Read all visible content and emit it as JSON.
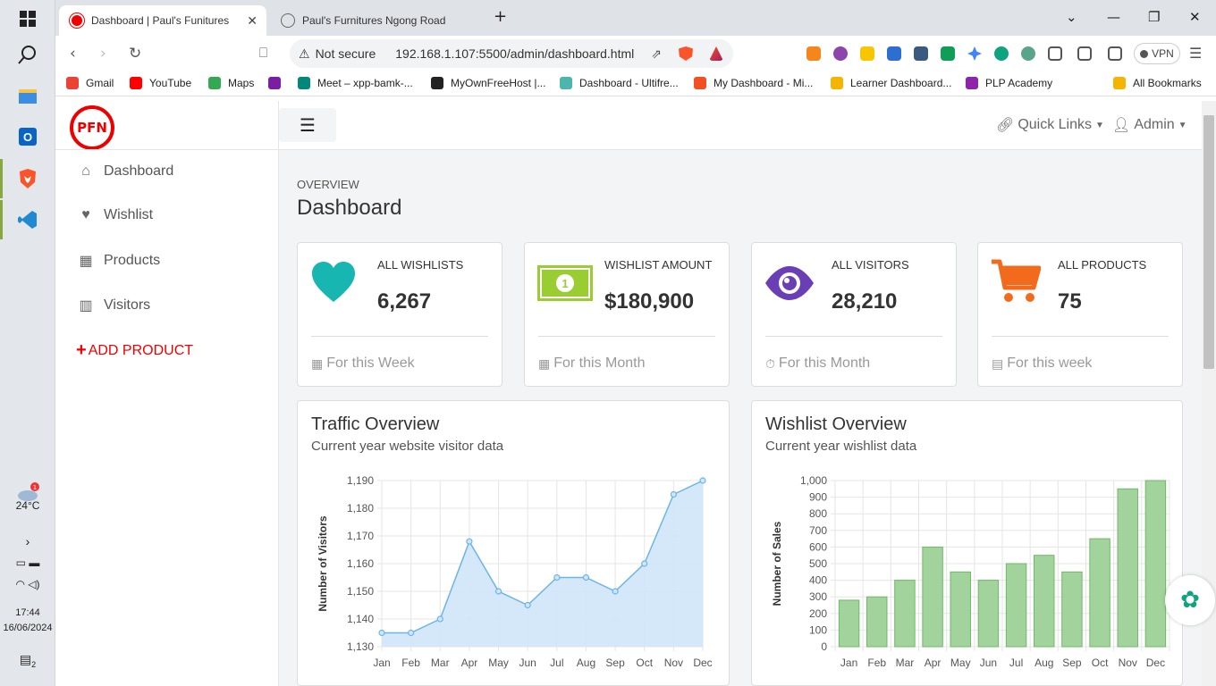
{
  "taskbar": {
    "weather_badge": "1",
    "temperature": "24°C",
    "time": "17:44",
    "date": "16/06/2024",
    "notification_count": "2"
  },
  "tabs": [
    {
      "title": "Dashboard | Paul's Funitures",
      "active": true
    },
    {
      "title": "Paul's Furnitures Ngong Road",
      "active": false
    }
  ],
  "address": {
    "security": "Not secure",
    "url": "192.168.1.107:5500/admin/dashboard.html",
    "vpn_label": "VPN"
  },
  "bookmarks": [
    {
      "label": "Gmail",
      "color": "#ea4335"
    },
    {
      "label": "YouTube",
      "color": "#ff0000"
    },
    {
      "label": "Maps",
      "color": "#34a853"
    },
    {
      "label": "Meet – xpp-bamk-...",
      "color": "#00897b"
    },
    {
      "label": "MyOwnFreeHost |...",
      "color": "#222222"
    },
    {
      "label": "Dashboard - Ultifre...",
      "color": "#4db6ac"
    },
    {
      "label": "My Dashboard - Mi...",
      "color": "#f25022"
    },
    {
      "label": "Learner Dashboard...",
      "color": "#f4b400"
    },
    {
      "label": "PLP Academy",
      "color": "#8e24aa"
    }
  ],
  "all_bookmarks": "All Bookmarks",
  "sidebar": {
    "logo_text": "PFN",
    "items": [
      {
        "label": "Dashboard",
        "icon": "home-icon"
      },
      {
        "label": "Wishlist",
        "icon": "heart-icon"
      },
      {
        "label": "Products",
        "icon": "table-icon"
      },
      {
        "label": "Visitors",
        "icon": "bar-chart-icon"
      }
    ],
    "add_product": "ADD PRODUCT"
  },
  "topnav": {
    "quick_links": "Quick Links",
    "admin": "Admin"
  },
  "header": {
    "overline": "OVERVIEW",
    "title": "Dashboard"
  },
  "cards": [
    {
      "label": "ALL WISHLISTS",
      "value": "6,267",
      "footer": "For this Week",
      "color": "#17b6b0"
    },
    {
      "label": "WISHLIST AMOUNT",
      "value": "$180,900",
      "footer": "For this Month",
      "color": "#9acd32"
    },
    {
      "label": "ALL VISITORS",
      "value": "28,210",
      "footer": "For this Month",
      "color": "#6a3fb5"
    },
    {
      "label": "ALL PRODUCTS",
      "value": "75",
      "footer": "For this week",
      "color": "#f26b1d"
    }
  ],
  "charts": {
    "traffic": {
      "title": "Traffic Overview",
      "subtitle": "Current year website visitor data"
    },
    "wishlist": {
      "title": "Wishlist Overview",
      "subtitle": "Current year wishlist data"
    }
  },
  "chart_data": [
    {
      "type": "area",
      "title": "Traffic Overview",
      "subtitle": "Current year website visitor data",
      "xlabel": "",
      "ylabel": "Number of Visitors",
      "categories": [
        "Jan",
        "Feb",
        "Mar",
        "Apr",
        "May",
        "Jun",
        "Jul",
        "Aug",
        "Sep",
        "Oct",
        "Nov",
        "Dec"
      ],
      "values": [
        1135,
        1135,
        1140,
        1168,
        1150,
        1145,
        1155,
        1155,
        1150,
        1160,
        1185,
        1190
      ],
      "ylim": [
        1130,
        1190
      ],
      "yticks": [
        "1,130",
        "1,140",
        "1,150",
        "1,160",
        "1,170",
        "1,180",
        "1,190"
      ],
      "grid": true,
      "colors": {
        "line": "#6bb4e8",
        "fill": "#cfe6fa"
      }
    },
    {
      "type": "bar",
      "title": "Wishlist Overview",
      "subtitle": "Current year wishlist data",
      "xlabel": "",
      "ylabel": "Number of Sales",
      "categories": [
        "Jan",
        "Feb",
        "Mar",
        "Apr",
        "May",
        "Jun",
        "Jul",
        "Aug",
        "Sep",
        "Oct",
        "Nov",
        "Dec"
      ],
      "values": [
        280,
        300,
        400,
        600,
        450,
        400,
        500,
        550,
        450,
        650,
        950,
        1000
      ],
      "ylim": [
        0,
        1000
      ],
      "yticks": [
        "0",
        "100",
        "200",
        "300",
        "400",
        "500",
        "600",
        "700",
        "800",
        "900",
        "1,000"
      ],
      "grid": true,
      "colors": {
        "bar": "#a3d39c",
        "border": "#6fb866"
      }
    }
  ]
}
